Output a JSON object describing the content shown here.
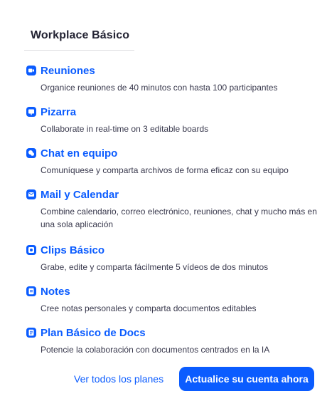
{
  "panel": {
    "title": "Workplace Básico"
  },
  "accent_color": "#0b5cff",
  "features": [
    {
      "icon": "video-camera-icon",
      "name": "Reuniones",
      "description": "Organice reuniones de 40 minutos con hasta 100 participantes"
    },
    {
      "icon": "whiteboard-icon",
      "name": "Pizarra",
      "description": "Collaborate in real-time on 3 editable boards"
    },
    {
      "icon": "chat-bubbles-icon",
      "name": "Chat en equipo",
      "description": "Comuníquese y comparta archivos de forma eficaz con su equipo"
    },
    {
      "icon": "mail-icon",
      "name": "Mail y Calendar",
      "description": "Combine calendario, correo electrónico, reuniones, chat y mucho más en una sola aplicación"
    },
    {
      "icon": "clips-icon",
      "name": "Clips Básico",
      "description": "Grabe, edite y comparta fácilmente 5 vídeos de dos minutos"
    },
    {
      "icon": "notes-icon",
      "name": "Notes",
      "description": "Cree notas personales y comparta documentos editables"
    },
    {
      "icon": "docs-icon",
      "name": "Plan Básico de Docs",
      "description": "Potencie la colaboración con documentos centrados en la IA"
    }
  ],
  "footer": {
    "plans_link": "Ver todos los planes",
    "upgrade_button": "Actualice su cuenta ahora"
  }
}
